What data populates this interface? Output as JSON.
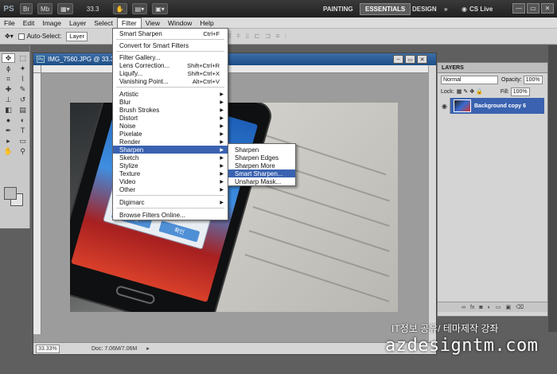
{
  "appbar": {
    "logo": "PS",
    "br_label": "Br",
    "mb_label": "Mb",
    "zoom": "33.3",
    "workspaces": [
      "PAINTING",
      "ESSENTIALS",
      "DESIGN"
    ],
    "more": "»",
    "cslive": "CS Live",
    "minimize": "—",
    "restore": "▭",
    "close": "✕"
  },
  "menubar": [
    "File",
    "Edit",
    "Image",
    "Layer",
    "Select",
    "Filter",
    "View",
    "Window",
    "Help"
  ],
  "options": {
    "auto_select_label": "Auto-Select:",
    "auto_select_value": "Layer"
  },
  "document": {
    "title": "IMG_7560.JPG @ 33.3%",
    "zoom": "33.33%",
    "doc_size": "Doc: 7.06M/7.06M",
    "icon_label": "Ps"
  },
  "filter_menu": {
    "items": [
      {
        "label": "Smart Sharpen",
        "shortcut": "Ctrl+F"
      },
      {
        "label": "Convert for Smart Filters"
      },
      {
        "label": "Filter Gallery..."
      },
      {
        "label": "Lens Correction...",
        "shortcut": "Shift+Ctrl+R"
      },
      {
        "label": "Liquify...",
        "shortcut": "Shift+Ctrl+X"
      },
      {
        "label": "Vanishing Point...",
        "shortcut": "Alt+Ctrl+V"
      },
      {
        "label": "Artistic"
      },
      {
        "label": "Blur"
      },
      {
        "label": "Brush Strokes"
      },
      {
        "label": "Distort"
      },
      {
        "label": "Noise"
      },
      {
        "label": "Pixelate"
      },
      {
        "label": "Render"
      },
      {
        "label": "Sharpen"
      },
      {
        "label": "Sketch"
      },
      {
        "label": "Stylize"
      },
      {
        "label": "Texture"
      },
      {
        "label": "Video"
      },
      {
        "label": "Other"
      },
      {
        "label": "Digimarc"
      },
      {
        "label": "Browse Filters Online..."
      }
    ]
  },
  "sharpen_submenu": [
    "Sharpen",
    "Sharpen Edges",
    "Sharpen More",
    "Smart Sharpen...",
    "Unsharp Mask..."
  ],
  "layers": {
    "tab": "LAYERS",
    "blend_mode": "Normal",
    "opacity_label": "Opacity:",
    "opacity": "100%",
    "lock_label": "Lock:",
    "fill_label": "Fill:",
    "fill": "100%",
    "layer_name": "Background copy 6",
    "bottom_icons": "∞  fx  ◐  ◑  ▭  ▣  🗑"
  },
  "photo": {
    "btn_left": "도움말",
    "btn_right": "확인"
  },
  "watermark": {
    "korean": "IT정보 공유/ 테마제작 강좌",
    "site": "azdesigntm.com"
  },
  "colors": {
    "menu_highlight": "#3a62b0",
    "doc_title": "#1e4e86"
  }
}
